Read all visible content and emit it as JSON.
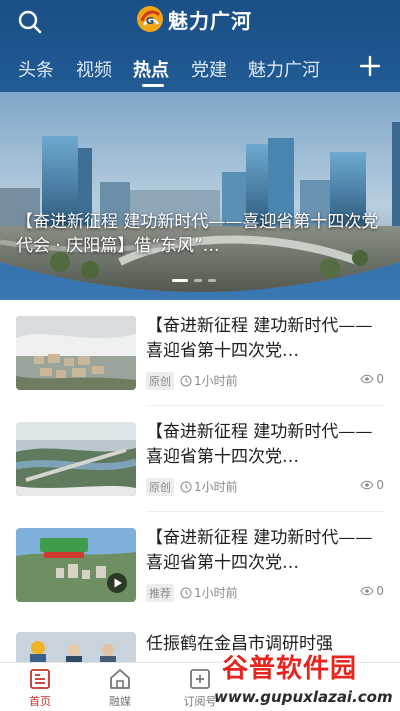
{
  "header": {
    "brand_name": "魅力广河",
    "search_icon": "search-icon",
    "logo_icon": "brand-logo-icon",
    "add_icon": "plus-icon"
  },
  "tabs": [
    {
      "label": "头条",
      "active": false
    },
    {
      "label": "视频",
      "active": false
    },
    {
      "label": "热点",
      "active": true
    },
    {
      "label": "党建",
      "active": false
    },
    {
      "label": "魅力广河",
      "active": false
    }
  ],
  "banner": {
    "caption": "【奋进新征程 建功新时代——喜迎省第十四次党代会 · 庆阳篇】借“东风”…",
    "slides": 3,
    "active_slide": 1
  },
  "news": [
    {
      "title": "【奋进新征程 建功新时代——喜迎省第十四次党…",
      "tag": "原创",
      "time": "1小时前",
      "views": "0",
      "thumb": "aerial-town-fog"
    },
    {
      "title": "【奋进新征程 建功新时代——喜迎省第十四次党…",
      "tag": "原创",
      "time": "1小时前",
      "views": "0",
      "thumb": "river-bridge-aerial"
    },
    {
      "title": "【奋进新征程 建功新时代——喜迎省第十四次党…",
      "tag": "推荐",
      "time": "1小时前",
      "views": "0",
      "thumb": "video-city-aerial"
    },
    {
      "title": "任振鹤在金昌市调研时强"
    }
  ],
  "bottom_nav": [
    {
      "label": "首页",
      "icon": "home-news-icon",
      "active": true
    },
    {
      "label": "融媒",
      "icon": "house-icon",
      "active": false
    },
    {
      "label": "订阅号",
      "icon": "subscribe-icon",
      "active": false
    }
  ],
  "watermark": {
    "title": "谷普软件园",
    "url": "www.gupuxlazai.com"
  },
  "colors": {
    "header_blue": "#25609b",
    "active_red": "#c4332a",
    "watermark_red": "#e7241d"
  }
}
